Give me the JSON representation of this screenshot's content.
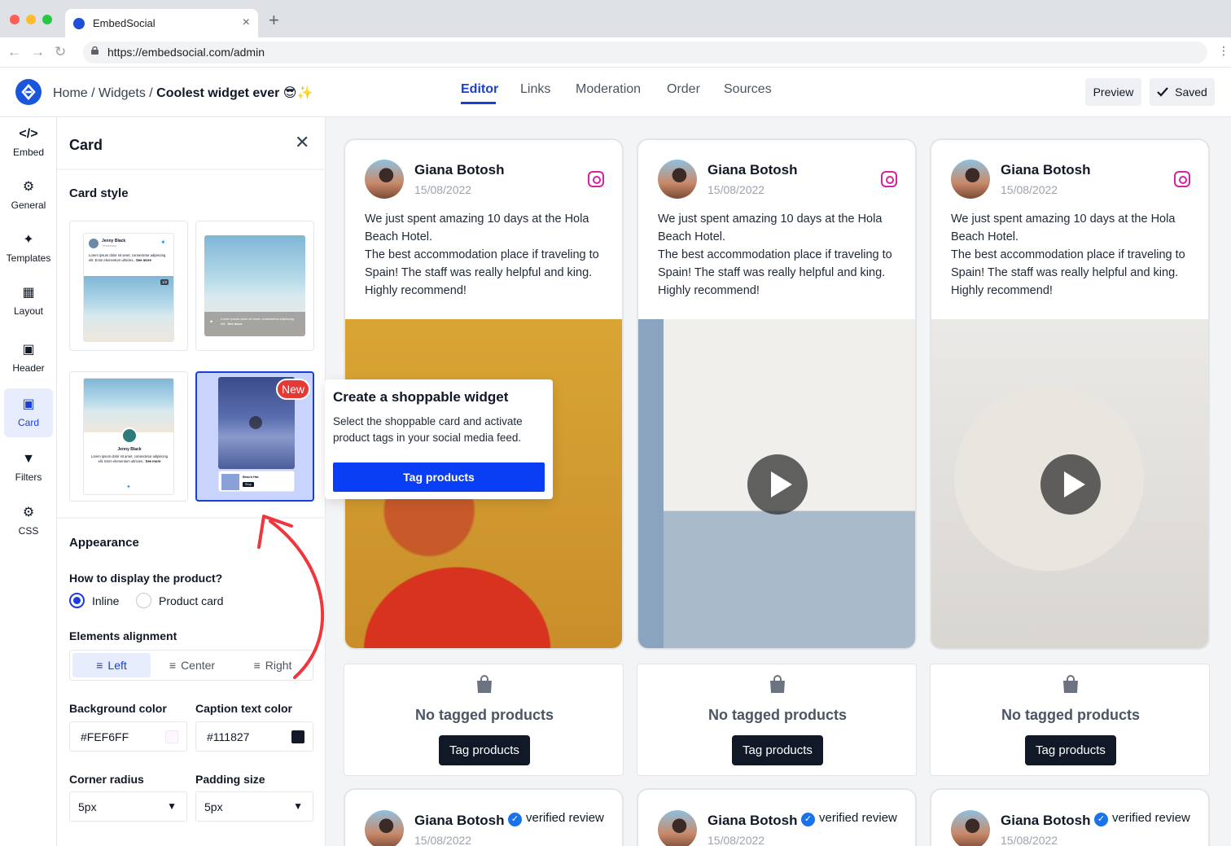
{
  "browser": {
    "tab_title": "EmbedSocial",
    "url": "https://embedsocial.com/admin",
    "new_tab": "+",
    "close_tab": "×"
  },
  "header": {
    "breadcrumb_home": "Home",
    "breadcrumb_widgets": "Widgets",
    "breadcrumb_current": "Coolest widget ever 😎✨",
    "tabs": [
      "Editor",
      "Links",
      "Moderation",
      "Order",
      "Sources"
    ],
    "active_tab": "Editor",
    "preview": "Preview",
    "saved": "Saved"
  },
  "rail": {
    "items": [
      {
        "label": "Embed",
        "icon": "code-icon"
      },
      {
        "label": "General",
        "icon": "gear-icon"
      },
      {
        "label": "Templates",
        "icon": "sparkle-icon"
      },
      {
        "label": "Layout",
        "icon": "layout-icon"
      },
      {
        "label": "Header",
        "icon": "header-icon"
      },
      {
        "label": "Card",
        "icon": "image-icon"
      },
      {
        "label": "Filters",
        "icon": "filter-icon"
      },
      {
        "label": "CSS",
        "icon": "gear-icon"
      }
    ],
    "active": "Card"
  },
  "panel": {
    "title": "Card",
    "card_style_title": "Card style",
    "new_badge": "New",
    "mini": {
      "name": "Jenny Black",
      "sub": "Yesterday",
      "body": "Lorem ipsum dolor sit amet, consectetur adipiscing elit. Enim elementum ultricies..",
      "see_more": "See more",
      "counter": "1/2",
      "overlay": "Lorem ipsum dolor sit amet, consectetur adipiscing elit..",
      "shop": "Beach Hat",
      "shop_btn": "Shop"
    },
    "appearance_title": "Appearance",
    "display_question": "How to display the product?",
    "display_options": [
      "Inline",
      "Product card"
    ],
    "display_selected": "Inline",
    "alignment_title": "Elements alignment",
    "alignment_options": [
      "Left",
      "Center",
      "Right"
    ],
    "alignment_selected": "Left",
    "bg_color_label": "Background color",
    "bg_color_value": "#FEF6FF",
    "caption_color_label": "Caption text color",
    "caption_color_value": "#111827",
    "corner_radius_label": "Corner radius",
    "corner_radius_value": "5px",
    "padding_label": "Padding size",
    "padding_value": "5px"
  },
  "tooltip": {
    "title": "Create a shoppable widget",
    "text": "Select the shoppable card and activate product tags in your social media feed.",
    "button": "Tag products"
  },
  "feed": {
    "posts": [
      {
        "name": "Giana Botosh",
        "date": "15/08/2022",
        "text": "We just spent amazing 10 days at the Hola Beach Hotel.\nThe best accommodation place if traveling to Spain! The staff was really helpful and king. Highly recommend!",
        "video": false
      },
      {
        "name": "Giana Botosh",
        "date": "15/08/2022",
        "text": "We just spent amazing 10 days at the Hola Beach Hotel.\nThe best accommodation place if traveling to Spain! The staff was really helpful and king. Highly recommend!",
        "video": true
      },
      {
        "name": "Giana Botosh",
        "date": "15/08/2022",
        "text": "We just spent amazing 10 days at the Hola Beach Hotel.\nThe best accommodation place if traveling to Spain! The staff was really helpful and king. Highly recommend!",
        "video": true
      }
    ],
    "no_products": "No tagged products",
    "tag_button": "Tag products",
    "review_name": "Giana Botosh",
    "review_badge": "verified review",
    "review_date": "15/08/2022"
  },
  "colors": {
    "accent": "#1A3FD6",
    "tooltip_button": "#0A3EF5",
    "arrow": "#F0363C",
    "new_badge": "#E53935",
    "dark_button": "#111827"
  }
}
